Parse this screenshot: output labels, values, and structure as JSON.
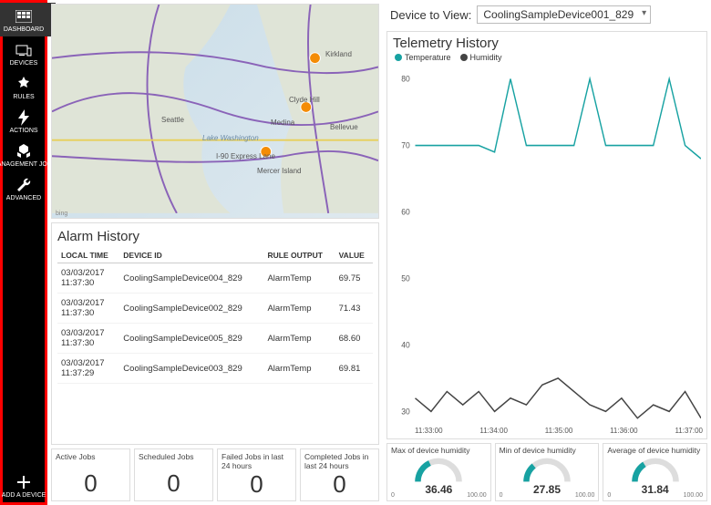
{
  "sidebar": {
    "items": [
      {
        "name": "dashboard",
        "label": "DASHBOARD",
        "icon": "grid-icon",
        "active": true
      },
      {
        "name": "devices",
        "label": "DEVICES",
        "icon": "devices-icon",
        "active": false
      },
      {
        "name": "rules",
        "label": "RULES",
        "icon": "rules-icon",
        "active": false
      },
      {
        "name": "actions",
        "label": "ACTIONS",
        "icon": "bolt-icon",
        "active": false
      },
      {
        "name": "management",
        "label": "MANAGEMENT JOBS",
        "icon": "cubes-icon",
        "active": false
      },
      {
        "name": "advanced",
        "label": "ADVANCED",
        "icon": "wrench-icon",
        "active": false
      }
    ],
    "add": {
      "label": "ADD A DEVICE",
      "icon": "plus-icon"
    }
  },
  "map": {
    "labels": {
      "seattle": "Seattle",
      "bellevue": "Bellevue",
      "mercer": "Mercer Island",
      "kirkland": "Kirkland",
      "medina": "Medina",
      "clyde": "Clyde Hill",
      "lake": "Lake Washington",
      "expressLane": "I-90 Express Lane",
      "provider": "bing"
    }
  },
  "alarm": {
    "title": "Alarm History",
    "headers": {
      "time": "LOCAL TIME",
      "device": "DEVICE ID",
      "rule": "RULE OUTPUT",
      "value": "VALUE"
    },
    "rows": [
      {
        "time": "03/03/2017 11:37:30",
        "device": "CoolingSampleDevice004_829",
        "rule": "AlarmTemp",
        "value": "69.75"
      },
      {
        "time": "03/03/2017 11:37:30",
        "device": "CoolingSampleDevice002_829",
        "rule": "AlarmTemp",
        "value": "71.43"
      },
      {
        "time": "03/03/2017 11:37:30",
        "device": "CoolingSampleDevice005_829",
        "rule": "AlarmTemp",
        "value": "68.60"
      },
      {
        "time": "03/03/2017 11:37:29",
        "device": "CoolingSampleDevice003_829",
        "rule": "AlarmTemp",
        "value": "69.81"
      }
    ]
  },
  "jobs": [
    {
      "title": "Active Jobs",
      "value": "0"
    },
    {
      "title": "Scheduled Jobs",
      "value": "0"
    },
    {
      "title": "Failed Jobs in last 24 hours",
      "value": "0"
    },
    {
      "title": "Completed Jobs in last 24 hours",
      "value": "0"
    }
  ],
  "device_select": {
    "label": "Device to View:",
    "value": "CoolingSampleDevice001_829"
  },
  "chart_data": {
    "type": "line",
    "title": "Telemetry History",
    "series": [
      {
        "name": "Temperature",
        "color": "#17a2a2",
        "values": [
          70,
          70,
          70,
          70,
          70,
          69,
          80,
          70,
          70,
          70,
          70,
          80,
          70,
          70,
          70,
          70,
          80,
          70,
          68
        ]
      },
      {
        "name": "Humidity",
        "color": "#444",
        "values": [
          32,
          30,
          33,
          31,
          33,
          30,
          32,
          31,
          34,
          35,
          33,
          31,
          30,
          32,
          29,
          31,
          30,
          33,
          29
        ]
      }
    ],
    "x_ticks": [
      "11:33:00",
      "11:34:00",
      "11:35:00",
      "11:36:00",
      "11:37:00"
    ],
    "y_ticks": [
      30,
      40,
      50,
      60,
      70,
      80
    ],
    "ylim": [
      28,
      82
    ]
  },
  "gauges": [
    {
      "title": "Max of device humidity",
      "value": "36.46",
      "min": "0",
      "max": "100.00",
      "pct": 0.36
    },
    {
      "title": "Min of device humidity",
      "value": "27.85",
      "min": "0",
      "max": "100.00",
      "pct": 0.28
    },
    {
      "title": "Average of device humidity",
      "value": "31.84",
      "min": "0",
      "max": "100.00",
      "pct": 0.32
    }
  ],
  "colors": {
    "accent": "#17a2a2",
    "dark": "#444"
  }
}
